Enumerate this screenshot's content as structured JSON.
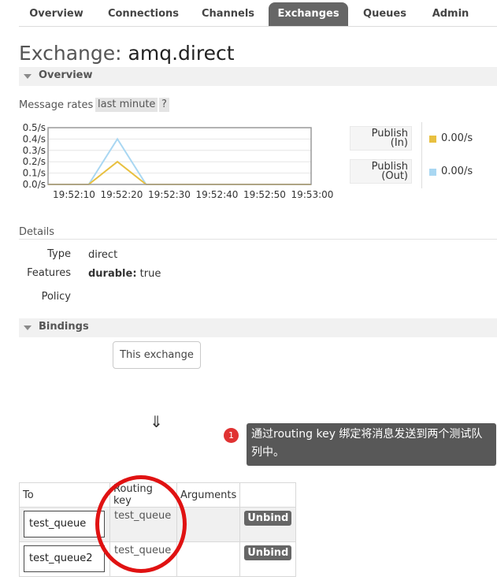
{
  "nav": {
    "items": [
      {
        "label": "Overview"
      },
      {
        "label": "Connections"
      },
      {
        "label": "Channels"
      },
      {
        "label": "Exchanges"
      },
      {
        "label": "Queues"
      },
      {
        "label": "Admin"
      }
    ],
    "active": "Exchanges"
  },
  "page": {
    "title_prefix": "Exchange:",
    "exchange_name": "amq.direct"
  },
  "overview": {
    "section_label": "Overview",
    "message_rates_label": "Message rates",
    "range_chip": "last minute",
    "help_chip": "?",
    "legend": [
      {
        "label_line1": "Publish",
        "label_line2": "(In)",
        "value": "0.00/s",
        "color": "#e8c040"
      },
      {
        "label_line1": "Publish",
        "label_line2": "(Out)",
        "value": "0.00/s",
        "color": "#a9d7f2"
      }
    ]
  },
  "chart_data": {
    "type": "line",
    "x": [
      "19:52:10",
      "19:52:20",
      "19:52:30",
      "19:52:40",
      "19:52:50",
      "19:53:00"
    ],
    "y_ticks": [
      "0.5/s",
      "0.4/s",
      "0.3/s",
      "0.2/s",
      "0.1/s",
      "0.0/s"
    ],
    "ylim": [
      0,
      0.5
    ],
    "xlim_seconds": [
      0,
      55
    ],
    "grid": true,
    "legend_placement": "right",
    "series": [
      {
        "name": "Publish (In)",
        "color": "#e8c040",
        "points": [
          [
            0,
            0
          ],
          [
            8.5,
            0
          ],
          [
            14.5,
            0.2
          ],
          [
            20.5,
            0
          ],
          [
            55,
            0
          ]
        ]
      },
      {
        "name": "Publish (Out)",
        "color": "#a9d7f2",
        "points": [
          [
            0,
            0
          ],
          [
            8.5,
            0
          ],
          [
            14.5,
            0.4
          ],
          [
            20.5,
            0
          ],
          [
            55,
            0
          ]
        ]
      }
    ]
  },
  "details": {
    "title": "Details",
    "type_label": "Type",
    "type_value": "direct",
    "features_label": "Features",
    "features_key": "durable:",
    "features_value": "true",
    "policy_label": "Policy"
  },
  "bindings": {
    "section_label": "Bindings",
    "this_exchange": "This exchange",
    "arrow": "⇓",
    "columns": [
      "To",
      "Routing key",
      "Arguments",
      ""
    ],
    "rows": [
      {
        "queue": "test_queue",
        "routing_key": "test_queue",
        "action": "Unbind"
      },
      {
        "queue": "test_queue2",
        "routing_key": "test_queue",
        "action": "Unbind"
      }
    ]
  },
  "annotation": {
    "badge": "1",
    "text": "通过routing key 绑定将消息发送到两个测试队列中。"
  }
}
